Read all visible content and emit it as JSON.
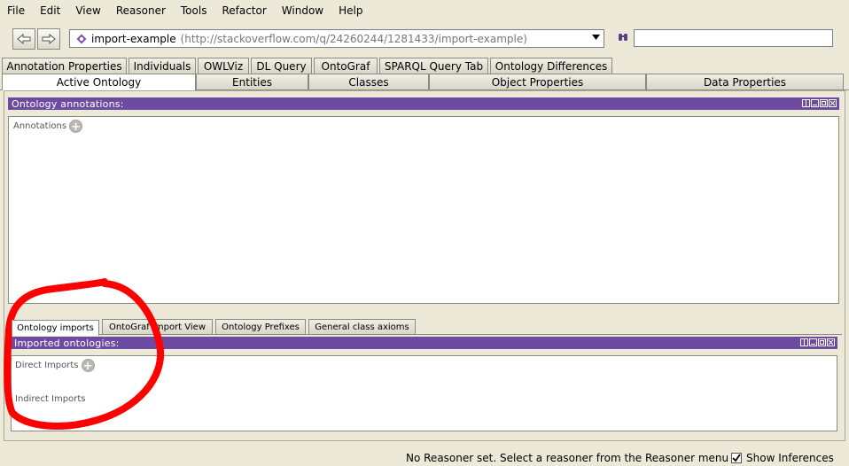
{
  "menubar": {
    "items": [
      "File",
      "Edit",
      "View",
      "Reasoner",
      "Tools",
      "Refactor",
      "Window",
      "Help"
    ]
  },
  "toolbar": {
    "back_icon": "back-arrow-icon",
    "forward_icon": "forward-arrow-icon",
    "ontology_name": "import-example",
    "ontology_iri": "(http://stackoverflow.com/q/24260244/1281433/import-example)",
    "search_value": ""
  },
  "tabs_row1": [
    "Annotation Properties",
    "Individuals",
    "OWLViz",
    "DL Query",
    "OntoGraf",
    "SPARQL Query Tab",
    "Ontology Differences"
  ],
  "tabs_row2": [
    "Active Ontology",
    "Entities",
    "Classes",
    "Object Properties",
    "Data Properties"
  ],
  "annotations_view": {
    "title": "Ontology annotations:",
    "section_label": "Annotations"
  },
  "footer_tabs": [
    "Ontology imports",
    "OntoGraf Import View",
    "Ontology Prefixes",
    "General class axioms"
  ],
  "imports_view": {
    "title": "Imported ontologies:",
    "direct_label": "Direct Imports",
    "indirect_label": "Indirect Imports"
  },
  "statusbar": {
    "message": "No Reasoner set. Select a reasoner from the Reasoner menu",
    "show_inferences_label": "Show Inferences",
    "show_inferences_checked": true
  },
  "colors": {
    "view_header": "#6d4ba1",
    "highlight_stroke": "#ff0000"
  }
}
